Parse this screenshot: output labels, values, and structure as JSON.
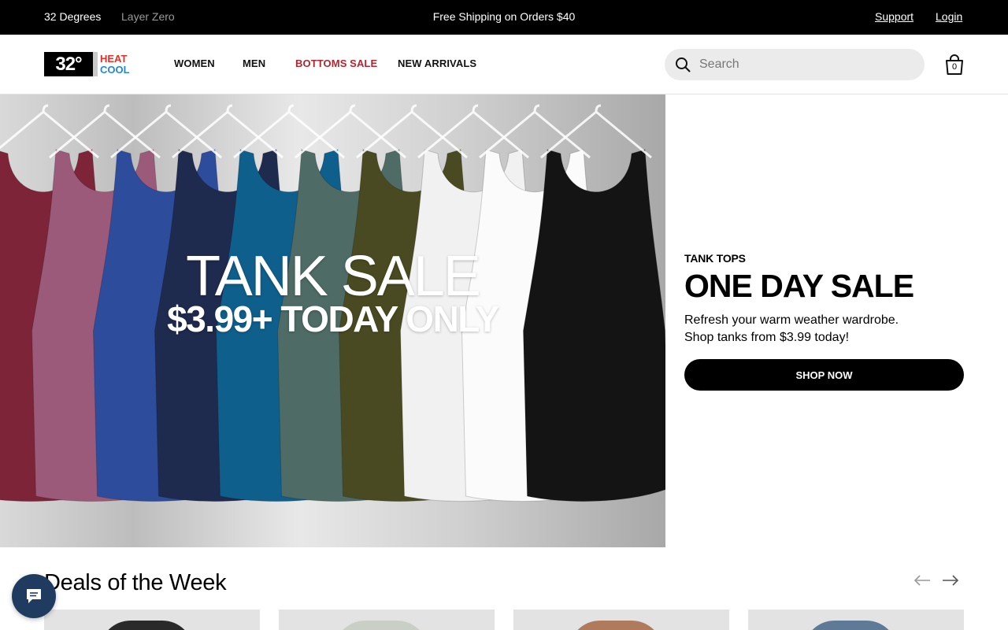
{
  "topbar": {
    "brand_primary": "32 Degrees",
    "brand_secondary": "Layer Zero",
    "promo": "Free Shipping on Orders $40",
    "support": "Support",
    "login": "Login"
  },
  "header": {
    "logo": {
      "number": "32°",
      "word_top": "HEAT",
      "word_bottom": "COOL"
    },
    "nav": [
      {
        "label": "WOMEN"
      },
      {
        "label": "MEN"
      },
      {
        "label": "BOTTOMS SALE"
      },
      {
        "label": "NEW ARRIVALS"
      }
    ],
    "search_placeholder": "Search",
    "cart_count": "0"
  },
  "hero": {
    "image_title": "TANK SALE",
    "image_subtitle": "$3.99+ TODAY ONLY",
    "eyebrow": "TANK TOPS",
    "headline": "ONE DAY SALE",
    "description_line1": "Refresh your warm weather wardrobe.",
    "description_line2": "Shop tanks from $3.99 today!",
    "cta": "SHOP NOW",
    "tank_colors": [
      "#7d2438",
      "#9c5a7b",
      "#2e4c9c",
      "#1f2a4f",
      "#0f5f8c",
      "#4e6b65",
      "#4a4a22",
      "#f1f1f1",
      "#fbfbfb",
      "#141414"
    ]
  },
  "deals": {
    "title": "Deals of the Week",
    "prev_icon": "arrow-left-icon",
    "next_icon": "arrow-right-icon"
  },
  "chat": {
    "icon": "chat-bubble-icon"
  },
  "colors": {
    "accent_sale": "#b3262f",
    "topbar_bg": "#000000",
    "search_bg": "#ebebeb"
  }
}
